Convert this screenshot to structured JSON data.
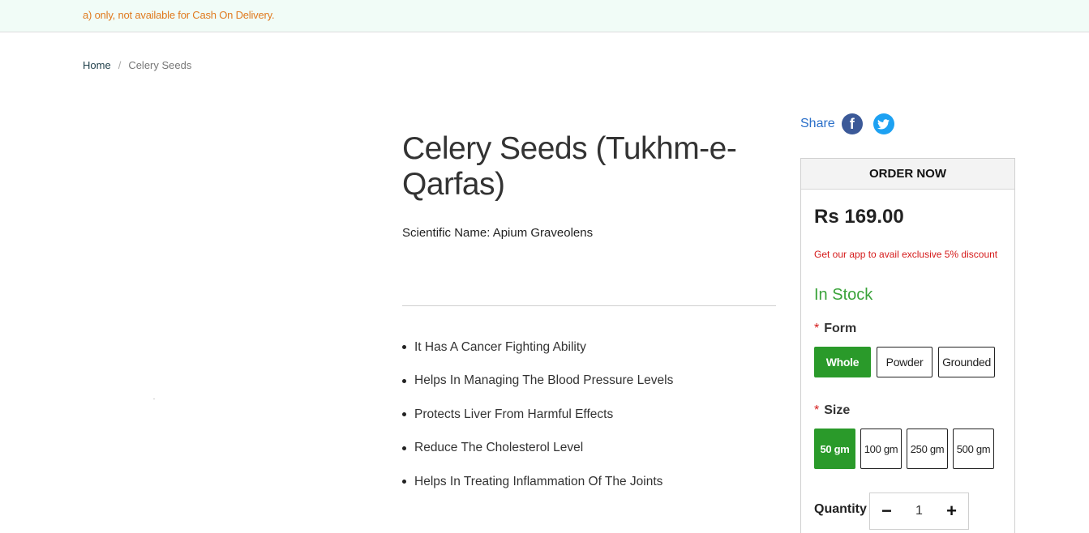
{
  "notice": {
    "text": "a) only, not available for Cash On Delivery."
  },
  "breadcrumb": {
    "home": "Home",
    "separator": "/",
    "current": "Celery Seeds"
  },
  "product": {
    "title": "Celery Seeds (Tukhm-e-Qarfas)",
    "scientific_name": "Scientific Name: Apium Graveolens",
    "features": [
      "It Has A Cancer Fighting Ability",
      "Helps In Managing The Blood Pressure Levels",
      "Protects Liver From Harmful Effects",
      "Reduce The Cholesterol Level",
      "Helps In Treating Inflammation Of The Joints"
    ]
  },
  "share": {
    "label": "Share",
    "facebook_glyph": "f",
    "twitter_glyph": "🐦"
  },
  "order": {
    "header": "ORDER NOW",
    "price": "Rs 169.00",
    "promo": "Get our app to avail exclusive 5% discount",
    "stock": "In Stock",
    "required_mark": "*",
    "form_label": "Form",
    "form_options": [
      "Whole",
      "Powder",
      "Grounded"
    ],
    "selected_form": "Whole",
    "size_label": "Size",
    "size_options": [
      "50 gm",
      "100 gm",
      "250 gm",
      "500 gm"
    ],
    "selected_size": "50 gm",
    "quantity_label": "Quantity",
    "quantity": "1",
    "minus": "−",
    "plus": "+"
  },
  "colors": {
    "accent_green": "#2a9a2a",
    "notice_orange": "#e07a1f",
    "promo_red": "#d51a1a",
    "link_blue": "#2a6fc9"
  }
}
